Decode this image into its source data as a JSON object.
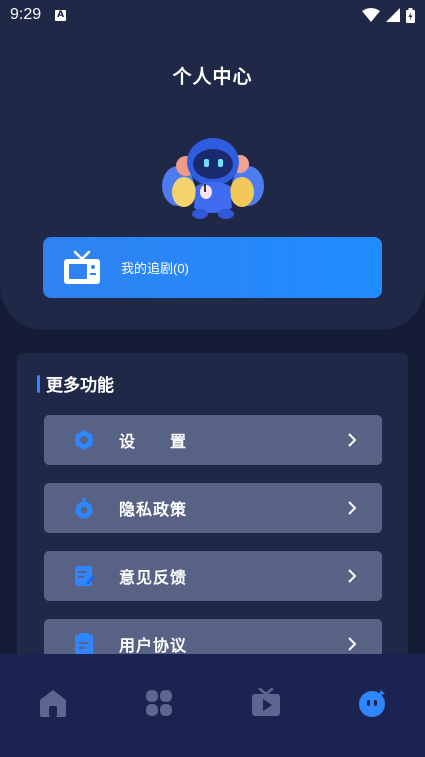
{
  "status_bar": {
    "time": "9:29",
    "notification_letter": "A"
  },
  "header": {
    "title": "个人中心"
  },
  "drama_card": {
    "label": "我的追剧(0)"
  },
  "more": {
    "title": "更多功能",
    "items": [
      {
        "label": "设　　置",
        "icon": "gear-icon"
      },
      {
        "label": "隐私政策",
        "icon": "privacy-icon"
      },
      {
        "label": "意见反馈",
        "icon": "feedback-icon"
      },
      {
        "label": "用户协议",
        "icon": "agreement-icon"
      }
    ]
  },
  "tabs": [
    {
      "name": "home",
      "icon": "home-icon",
      "active": false
    },
    {
      "name": "discover",
      "icon": "clover-icon",
      "active": false
    },
    {
      "name": "theater",
      "icon": "play-tv-icon",
      "active": false
    },
    {
      "name": "mine",
      "icon": "mascot-face-icon",
      "active": true
    }
  ],
  "colors": {
    "background": "#151c35",
    "panel": "#1f2847",
    "accent": "#2f86ff",
    "menu_item": "#586284",
    "tab_bar": "#1b2350",
    "tab_inactive": "#5d6690"
  }
}
